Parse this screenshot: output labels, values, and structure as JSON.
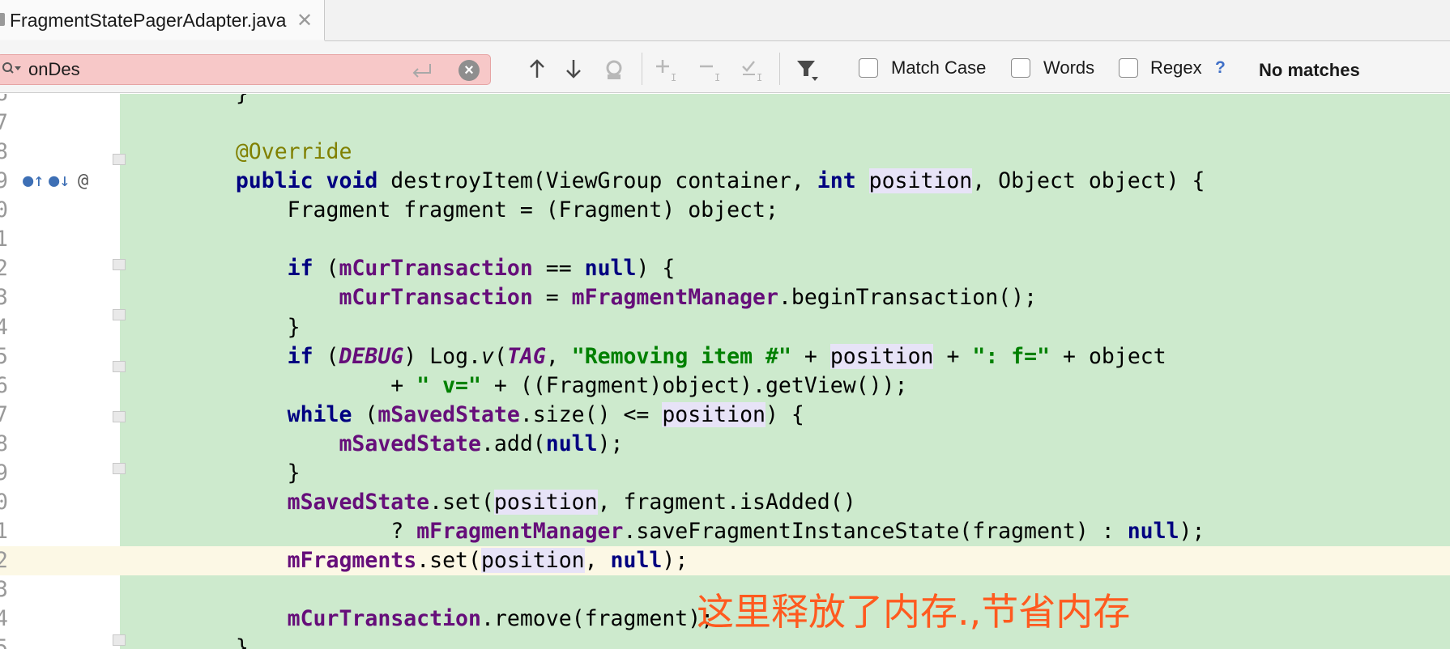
{
  "tab": {
    "title": "FragmentStatePagerAdapter.java",
    "close": "✕"
  },
  "search": {
    "query": "onDes",
    "match_case_label": "Match Case",
    "words_label": "Words",
    "regex_label": "Regex",
    "help": "?",
    "status": "No matches"
  },
  "editor": {
    "lines": [
      {
        "num": "6",
        "code": "    }"
      },
      {
        "num": "7",
        "code": ""
      },
      {
        "num": "8",
        "code": "    @Override"
      },
      {
        "num": "9",
        "code": "    public void destroyItem(ViewGroup container, int position, Object object) {"
      },
      {
        "num": "0",
        "code": "        Fragment fragment = (Fragment) object;"
      },
      {
        "num": "1",
        "code": ""
      },
      {
        "num": "2",
        "code": "        if (mCurTransaction == null) {"
      },
      {
        "num": "3",
        "code": "            mCurTransaction = mFragmentManager.beginTransaction();"
      },
      {
        "num": "4",
        "code": "        }"
      },
      {
        "num": "5",
        "code": "        if (DEBUG) Log.v(TAG, \"Removing item #\" + position + \": f=\" + object"
      },
      {
        "num": "6",
        "code": "                + \" v=\" + ((Fragment)object).getView());"
      },
      {
        "num": "7",
        "code": "        while (mSavedState.size() <= position) {"
      },
      {
        "num": "8",
        "code": "            mSavedState.add(null);"
      },
      {
        "num": "9",
        "code": "        }"
      },
      {
        "num": "0",
        "code": "        mSavedState.set(position, fragment.isAdded()"
      },
      {
        "num": "1",
        "code": "                ? mFragmentManager.saveFragmentInstanceState(fragment) : null);"
      },
      {
        "num": "2",
        "code": "        mFragments.set(position, null);"
      },
      {
        "num": "3",
        "code": ""
      },
      {
        "num": "4",
        "code": "        mCurTransaction.remove(fragment);"
      },
      {
        "num": "5",
        "code": "    }"
      }
    ],
    "annotation": "这里释放了内存.,节省内存",
    "gutter_icons": [
      "override-up-icon",
      "override-down-icon",
      "at-icon"
    ]
  },
  "colors": {
    "code_bg": "#cdeacd",
    "current_line": "#fcf8e5",
    "search_no_match": "#f7c8c8",
    "keyword": "#000080",
    "field": "#660e7a",
    "string": "#008000",
    "annotation_text": "#ff5a1f"
  }
}
